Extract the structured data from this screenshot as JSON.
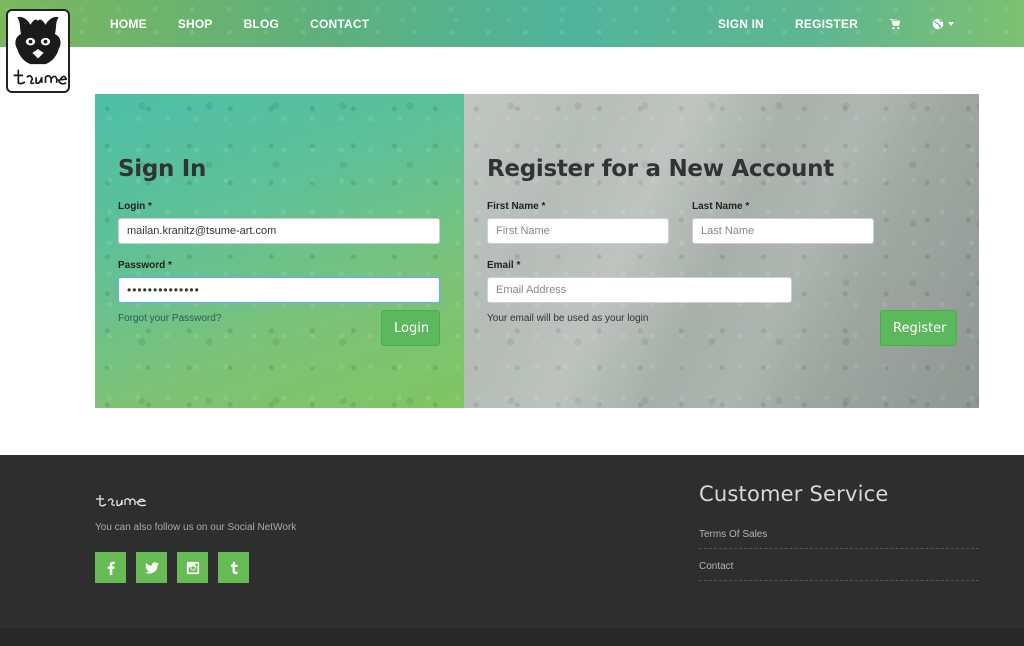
{
  "nav": {
    "left": [
      {
        "label": "HOME"
      },
      {
        "label": "SHOP"
      },
      {
        "label": "BLOG"
      },
      {
        "label": "CONTACT"
      }
    ],
    "sign_in": "SIGN IN",
    "register": "REGISTER",
    "icons": [
      "cart-icon",
      "globe-icon",
      "chevron-down-icon"
    ]
  },
  "logo": {
    "text": "tsume"
  },
  "signin": {
    "title": "Sign In",
    "login_label": "Login *",
    "login_value": "mailan.kranitz@tsume-art.com",
    "password_label": "Password *",
    "password_value": "••••••••••••••",
    "forgot": "Forgot your Password?",
    "button": "Login"
  },
  "register": {
    "title": "Register for a New Account",
    "first_name_label": "First Name *",
    "first_name_placeholder": "First Name",
    "last_name_label": "Last Name *",
    "last_name_placeholder": "Last Name",
    "email_label": "Email *",
    "email_placeholder": "Email Address",
    "hint": "Your email will be used as your login",
    "button": "Register"
  },
  "footer": {
    "logo_text": "tsume",
    "follow_text": "You can also follow us on our Social NetWork",
    "social": [
      "facebook-icon",
      "twitter-icon",
      "instagram-icon",
      "tumblr-icon"
    ],
    "customer_service": {
      "title": "Customer Service",
      "links": [
        {
          "label": "Terms Of Sales"
        },
        {
          "label": "Contact"
        }
      ]
    }
  },
  "colors": {
    "accent_green": "#5cb85c",
    "footer_bg": "#2e2e2e",
    "social_green": "#66bb55"
  }
}
